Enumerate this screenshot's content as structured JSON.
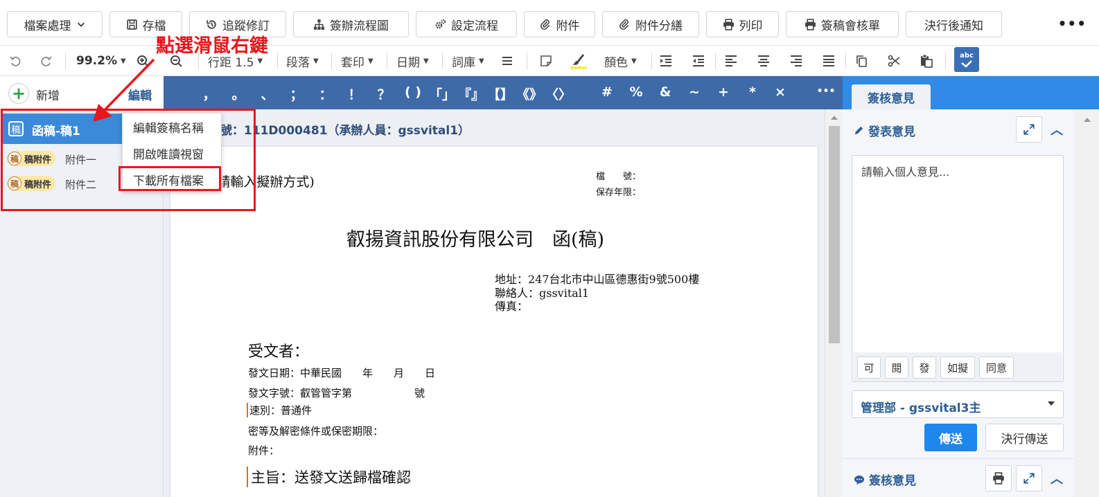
{
  "toolbar": {
    "file_menu": "檔案處理",
    "save": "存檔",
    "track": "追蹤修訂",
    "flowchart": "簽辦流程圖",
    "setflow": "設定流程",
    "attach": "附件",
    "attach_split": "附件分繕",
    "print": "列印",
    "print_sheet": "簽稿會核單",
    "notify": "決行後通知",
    "more": "•••"
  },
  "format_bar": {
    "zoom": "99.2%",
    "line_spacing": "行距 1.5",
    "paragraph": "段落",
    "template": "套印",
    "date": "日期",
    "vocab": "詞庫",
    "color": "顏色",
    "spell_label": "abc"
  },
  "left_panel": {
    "add_label": "新增",
    "edit_label": "編輯",
    "draft_icon_char": "稿",
    "draft_name": "函稿-稿1",
    "attachments": [
      {
        "badge_char": "稿",
        "badge": "稿附件",
        "name": "附件一"
      },
      {
        "badge_char": "稿",
        "badge": "稿附件",
        "name": "附件二"
      }
    ]
  },
  "context_menu": {
    "items": [
      "編輯簽稿名稱",
      "開啟唯讀視窗",
      "下載所有檔案"
    ]
  },
  "annotation": {
    "text": "點選滑鼠右鍵",
    "color": "#e8161d"
  },
  "punctuation": [
    "，",
    "。",
    "、",
    "；",
    "：",
    "！",
    "？",
    "( )",
    "「」",
    "『』",
    "【】",
    "《》",
    "〈〉",
    "#",
    "%",
    "&",
    "~",
    "+",
    "*",
    "×",
    "•••"
  ],
  "document": {
    "doc_number": "公文文號：111D000481（承辦人員：gssvital1）",
    "method": "(請輸入擬辦方式)",
    "file_no_label": "檔　　號：",
    "retention_label": "保存年限：",
    "title": "叡揚資訊股份有限公司　函(稿)",
    "address": "地址：247台北市中山區德惠街9號500樓",
    "contact": "聯絡人：gssvital1",
    "fax": "傳真：",
    "recipient": "受文者：",
    "send_date": "發文日期：中華民國　　年　　月　　日",
    "send_no": "發文字號：叡管管字第　　　　　　號",
    "speed": "速別：普通件",
    "secret": "密等及解密條件或保密期限：",
    "attachment": "附件：",
    "subject": "主旨：送發文送歸檔確認"
  },
  "right_panel": {
    "tab": "簽核意見",
    "post_opinion": "發表意見",
    "opinion_placeholder": "請輸入個人意見...",
    "phrases": [
      "可",
      "閱",
      "發",
      "如擬",
      "同意"
    ],
    "recipient_select": "管理部 - gssvital3主",
    "send": "傳送",
    "exec_send": "決行傳送",
    "opinion_history": "簽核意見"
  }
}
